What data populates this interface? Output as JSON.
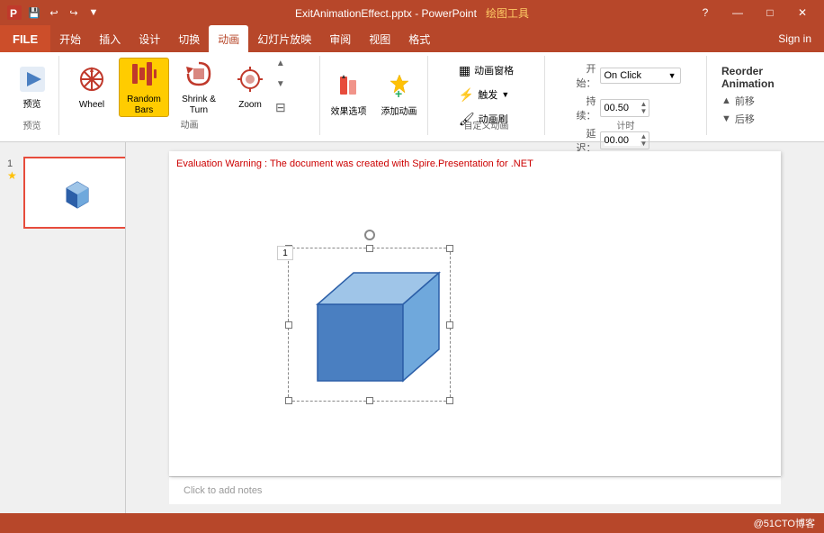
{
  "titlebar": {
    "filename": "ExitAnimationEffect.pptx - PowerPoint",
    "drawing_tools": "绘图工具",
    "help_icon": "?",
    "minimize_icon": "—",
    "restore_icon": "□",
    "close_icon": "✕",
    "save_icon": "💾",
    "undo_icon": "↩",
    "redo_icon": "↪"
  },
  "menubar": {
    "file": "FILE",
    "tabs": [
      "开始",
      "插入",
      "设计",
      "切换",
      "动画",
      "幻灯片放映",
      "审阅",
      "视图",
      "格式"
    ],
    "active_tab": "动画",
    "sign_in": "Sign in"
  },
  "ribbon": {
    "preview_label": "预览",
    "preview_btn": "预览",
    "animation_group_label": "动画",
    "animations": [
      {
        "id": "wheel",
        "label": "Wheel",
        "icon": "✳"
      },
      {
        "id": "random_bars",
        "label": "Random Bars",
        "icon": "≡"
      },
      {
        "id": "shrink_turn",
        "label": "Shrink & Turn",
        "icon": "↺"
      },
      {
        "id": "zoom",
        "label": "Zoom",
        "icon": "⊕"
      }
    ],
    "active_animation": "random_bars",
    "effect_options_label": "效果选项",
    "add_animation_label": "添加动画",
    "animation_pane_label": "动画窗格",
    "trigger_label": "触发",
    "animation_brush_label": "动画刷",
    "custom_animation_group_label": "自定义动画",
    "timing_group_label": "计时",
    "start_label": "开始：",
    "start_value": "On Click",
    "duration_label": "持续：",
    "duration_value": "00.50",
    "delay_label": "延迟：",
    "delay_value": "00.00",
    "reorder_animation_title": "Reorder Animation",
    "move_earlier_label": "▲ 前移",
    "move_later_label": "▼ 后移"
  },
  "slide_panel": {
    "slide_number": "1",
    "star_symbol": "★"
  },
  "canvas": {
    "eval_warning": "Evaluation Warning : The document was created with  Spire.Presentation for .NET",
    "animation_number": "1",
    "notes_placeholder": "Click to add notes"
  },
  "statusbar": {
    "watermark": "@51CTO博客"
  }
}
